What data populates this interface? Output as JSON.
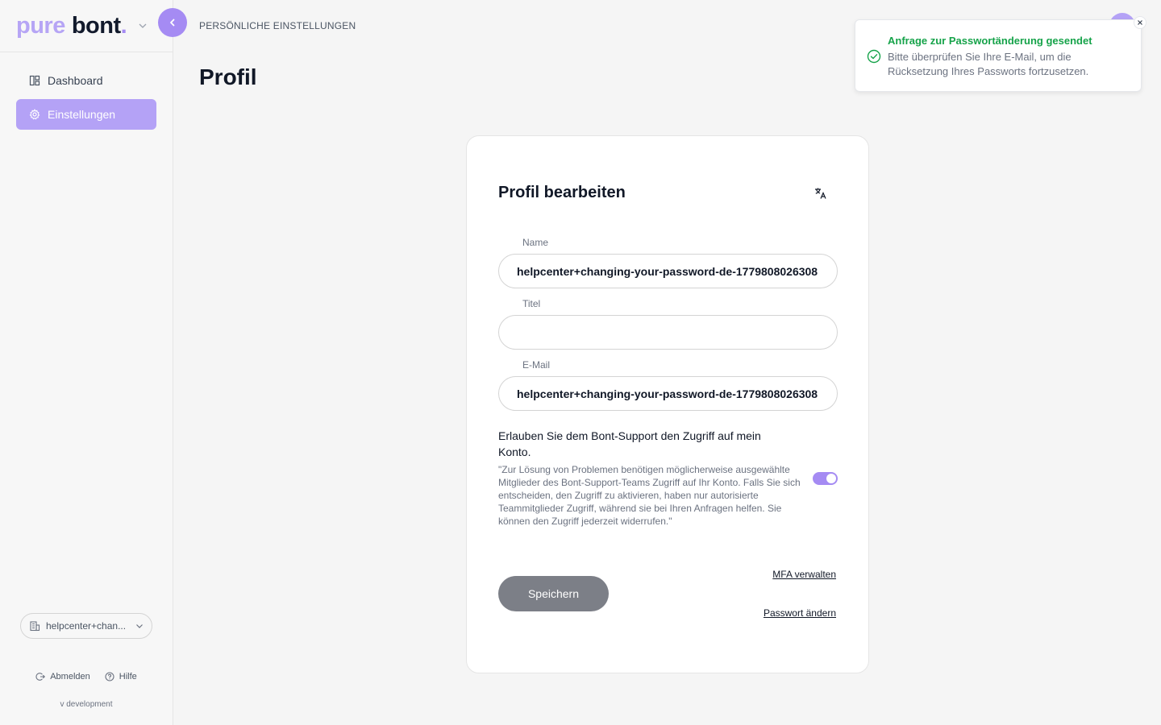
{
  "brand": {
    "part1": "pure",
    "part2": "bont",
    "dot": "."
  },
  "sidebar": {
    "items": [
      {
        "label": "Dashboard",
        "icon": "dashboard-icon",
        "active": false
      },
      {
        "label": "Einstellungen",
        "icon": "gear-icon",
        "active": true
      }
    ],
    "org_select": {
      "value": "helpcenter+chan...",
      "icon": "building-icon"
    },
    "logout_label": "Abmelden",
    "help_label": "Hilfe",
    "version": "v development"
  },
  "header": {
    "breadcrumb": "PERSÖNLICHE EINSTELLUNGEN",
    "title": "Profil"
  },
  "toast": {
    "title": "Anfrage zur Passwortänderung gesendet",
    "message": "Bitte überprüfen Sie Ihre E-Mail, um die Rücksetzung Ihres Passworts fortzusetzen.",
    "icon": "check-circle-icon",
    "color": "#16a34a"
  },
  "form": {
    "title": "Profil bearbeiten",
    "name_label": "Name",
    "name_value": "helpcenter+changing-your-password-de-1779808026308",
    "title_label": "Titel",
    "title_value": "",
    "email_label": "E-Mail",
    "email_value": "helpcenter+changing-your-password-de-1779808026308",
    "consent_title": "Erlauben Sie dem Bont-Support den Zugriff auf mein Konto.",
    "consent_text": "\"Zur Lösung von Problemen benötigen möglicherweise ausgewählte Mitglieder des Bont-Support-Teams Zugriff auf Ihr Konto. Falls Sie sich entscheiden, den Zugriff zu aktivieren, haben nur autorisierte Teammitglieder Zugriff, während sie bei Ihren Anfragen helfen. Sie können den Zugriff jederzeit widerrufen.\"",
    "consent_enabled": true,
    "save_label": "Speichern",
    "mfa_link": "MFA verwalten",
    "password_link": "Passwort ändern"
  },
  "colors": {
    "accent": "#a58bf3",
    "accent_light": "#b4a2f6",
    "success": "#16a34a",
    "save_button": "#7c7f87"
  }
}
